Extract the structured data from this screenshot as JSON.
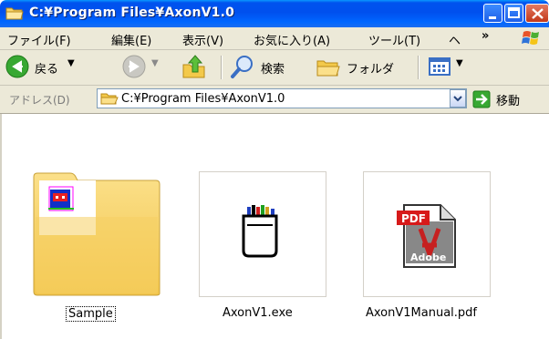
{
  "window": {
    "title": "C:¥Program Files¥AxonV1.0",
    "title_icon": "folder-icon",
    "controls": {
      "minimize_icon": "minimize-icon",
      "maximize_icon": "maximize-icon",
      "close_icon": "close-icon"
    }
  },
  "menubar": {
    "items": [
      "ファイル(F)",
      "編集(E)",
      "表示(V)",
      "お気に入り(A)",
      "ツール(T)",
      "ヘ"
    ],
    "overflow": "»",
    "logo_icon": "windows-logo-icon"
  },
  "toolbar": {
    "back_label": "戻る",
    "back_icon": "back-arrow-icon",
    "forward_icon": "forward-arrow-icon",
    "up_icon": "folder-up-icon",
    "search_label": "検索",
    "search_icon": "search-icon",
    "folders_label": "フォルダ",
    "folders_icon": "folders-icon",
    "views_icon": "views-icon"
  },
  "address": {
    "label": "アドレス(D)",
    "value": "C:¥Program Files¥AxonV1.0",
    "go_label": "移動",
    "go_icon": "go-arrow-icon"
  },
  "files": [
    {
      "name": "Sample",
      "type": "folder",
      "icon": "folder-thumbnail-icon",
      "selected_focus": true
    },
    {
      "name": "AxonV1.exe",
      "type": "exe",
      "icon": "exe-app-icon"
    },
    {
      "name": "AxonV1Manual.pdf",
      "type": "pdf",
      "icon": "pdf-icon",
      "badge_text": "PDF",
      "brand_text": "Adobe"
    }
  ],
  "colors": {
    "titlebar": "#0054e3",
    "chrome": "#ece9d8",
    "close": "#d9532e",
    "folder": "#f5d77e"
  }
}
